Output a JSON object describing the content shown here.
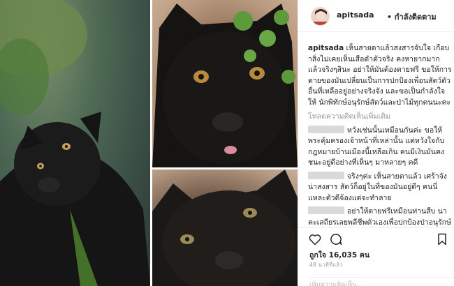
{
  "post": {
    "username": "apitsada",
    "follow_label": "• กำลังติดตาม",
    "caption": "เห็นสายตาแล้วสงสารจับใจ เกือบาสิ่งไม่เคยเห็นเสือดำตัวจริง คงหายากมากแล้วจริงๆสินะ อย่าให้มันต้องตายฟรี ขอให้การตายของมันเปลี่ยนเป็นการปกป้องเพื่อนสัตว์ตัวอื่นที่เหลืออยู่อย่างจริงจัง และขอเป็นกำลังใจให้ นักพิทักษ์อนุรักษ์สัตว์และป่าไม้ทุกคนนะคะ",
    "load_more": "โหลดความคิดเห็นเพิ่มเติม",
    "comments": [
      "หวังเช่นนั้นเหมือนกันค่ะ ขอให้พระคุ้มครองเจ้าหน้าที่เหล่านั้น แต่หวังใจกับกฎหมายบ้านเมืองนี้เหลือเกิน คนมีเงินมันคงชนะอยู่ดีอย่างที่เห็นๆ มาหลายๆ คดี",
      "จริงๆค่ะ เห็นสายตาแล้ว เศร้าจัง น่าสงสาร สัตว์ก็อยู่ในที่ของมันอยู่ดีๆ คนนี่แหละตัวดีจ้องแต่จะทำลาย",
      "อย่าให้ตายฟรีเหมือนท่านสืบ นาคะเสถียรเลยพลีชีพตัวเองเพื่อปกป้องป่าอนุรักษ์หวงแหนป่าไว้ให้รุ่นลูกหลานๆ ต่อสู้กับพวกนายทุนที่โรงจรรยาบรรณ แต่ท่านก็ต้องมาตายเพราะคนมีอิทธิพลมีอำนาจ เศร้าใจจริงๆ ขอให้มาเรียนเรื่องนี้"
    ],
    "likes": "ถูกใจ 16,035 คน",
    "time": "48 นาทีที่แล้ว",
    "add_comment": "เพิ่มความคิดเห็น..."
  },
  "icons": [
    "heart-icon",
    "comment-icon",
    "bookmark-icon"
  ],
  "colors": {
    "text": "#262626",
    "muted": "#999999",
    "border": "#efefef"
  }
}
